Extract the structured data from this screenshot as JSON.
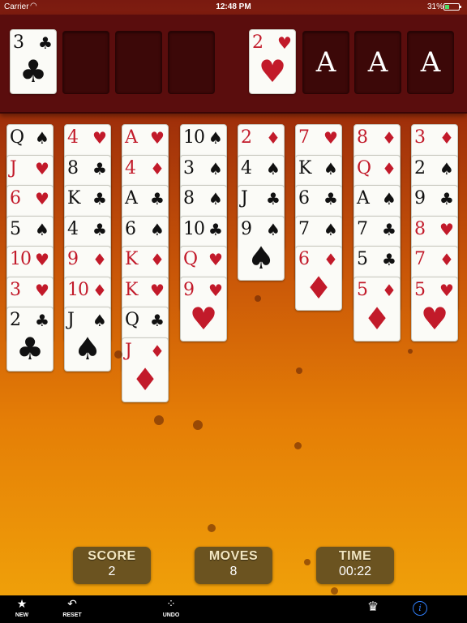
{
  "status_bar": {
    "carrier": "Carrier",
    "time": "12:48 PM",
    "battery": "31%",
    "battery_level": 0.31
  },
  "free_cells": [
    {
      "rank": "3",
      "suit": "♣",
      "color": "black"
    },
    null,
    null,
    null
  ],
  "foundations": [
    {
      "rank": "2",
      "suit": "♥",
      "color": "red"
    },
    {
      "placeholder": "A"
    },
    {
      "placeholder": "A"
    },
    {
      "placeholder": "A"
    }
  ],
  "tableau": [
    [
      {
        "rank": "Q",
        "suit": "♠",
        "color": "black"
      },
      {
        "rank": "J",
        "suit": "♥",
        "color": "red"
      },
      {
        "rank": "6",
        "suit": "♥",
        "color": "red"
      },
      {
        "rank": "5",
        "suit": "♠",
        "color": "black"
      },
      {
        "rank": "10",
        "suit": "♥",
        "color": "red"
      },
      {
        "rank": "3",
        "suit": "♥",
        "color": "red"
      },
      {
        "rank": "2",
        "suit": "♣",
        "color": "black"
      }
    ],
    [
      {
        "rank": "4",
        "suit": "♥",
        "color": "red"
      },
      {
        "rank": "8",
        "suit": "♣",
        "color": "black"
      },
      {
        "rank": "K",
        "suit": "♣",
        "color": "black"
      },
      {
        "rank": "4",
        "suit": "♣",
        "color": "black"
      },
      {
        "rank": "9",
        "suit": "♦",
        "color": "red"
      },
      {
        "rank": "10",
        "suit": "♦",
        "color": "red"
      },
      {
        "rank": "J",
        "suit": "♠",
        "color": "black"
      }
    ],
    [
      {
        "rank": "A",
        "suit": "♥",
        "color": "red"
      },
      {
        "rank": "4",
        "suit": "♦",
        "color": "red"
      },
      {
        "rank": "A",
        "suit": "♣",
        "color": "black"
      },
      {
        "rank": "6",
        "suit": "♠",
        "color": "black"
      },
      {
        "rank": "K",
        "suit": "♦",
        "color": "red"
      },
      {
        "rank": "K",
        "suit": "♥",
        "color": "red"
      },
      {
        "rank": "Q",
        "suit": "♣",
        "color": "black"
      },
      {
        "rank": "J",
        "suit": "♦",
        "color": "red"
      }
    ],
    [
      {
        "rank": "10",
        "suit": "♠",
        "color": "black"
      },
      {
        "rank": "3",
        "suit": "♠",
        "color": "black"
      },
      {
        "rank": "8",
        "suit": "♠",
        "color": "black"
      },
      {
        "rank": "10",
        "suit": "♣",
        "color": "black"
      },
      {
        "rank": "Q",
        "suit": "♥",
        "color": "red"
      },
      {
        "rank": "9",
        "suit": "♥",
        "color": "red"
      }
    ],
    [
      {
        "rank": "2",
        "suit": "♦",
        "color": "red"
      },
      {
        "rank": "4",
        "suit": "♠",
        "color": "black"
      },
      {
        "rank": "J",
        "suit": "♣",
        "color": "black"
      },
      {
        "rank": "9",
        "suit": "♠",
        "color": "black"
      }
    ],
    [
      {
        "rank": "7",
        "suit": "♥",
        "color": "red"
      },
      {
        "rank": "K",
        "suit": "♠",
        "color": "black"
      },
      {
        "rank": "6",
        "suit": "♣",
        "color": "black"
      },
      {
        "rank": "7",
        "suit": "♠",
        "color": "black"
      },
      {
        "rank": "6",
        "suit": "♦",
        "color": "red"
      }
    ],
    [
      {
        "rank": "8",
        "suit": "♦",
        "color": "red"
      },
      {
        "rank": "Q",
        "suit": "♦",
        "color": "red"
      },
      {
        "rank": "A",
        "suit": "♠",
        "color": "black"
      },
      {
        "rank": "7",
        "suit": "♣",
        "color": "black"
      },
      {
        "rank": "5",
        "suit": "♣",
        "color": "black"
      },
      {
        "rank": "5",
        "suit": "♦",
        "color": "red"
      }
    ],
    [
      {
        "rank": "3",
        "suit": "♦",
        "color": "red"
      },
      {
        "rank": "2",
        "suit": "♠",
        "color": "black"
      },
      {
        "rank": "9",
        "suit": "♣",
        "color": "black"
      },
      {
        "rank": "8",
        "suit": "♥",
        "color": "red"
      },
      {
        "rank": "7",
        "suit": "♦",
        "color": "red"
      },
      {
        "rank": "5",
        "suit": "♥",
        "color": "red"
      }
    ]
  ],
  "stats": {
    "score_label": "SCORE",
    "score": "2",
    "moves_label": "MOVES",
    "moves": "8",
    "time_label": "TIME",
    "time": "00:22"
  },
  "toolbar": {
    "new_label": "NEW",
    "reset_label": "RESET",
    "undo_label": "UNDO",
    "new_icon": "star-icon",
    "reset_icon": "reset-arrow-icon",
    "undo_icon": "undo-footsteps-icon",
    "crown_icon": "crown-icon",
    "info_icon": "info-icon"
  },
  "colors": {
    "red_suit": "#c21a2a",
    "black_suit": "#111111",
    "top_bar": "#5a0d0d",
    "stat_box": "#6b5320",
    "info_blue": "#2f7cf6"
  }
}
